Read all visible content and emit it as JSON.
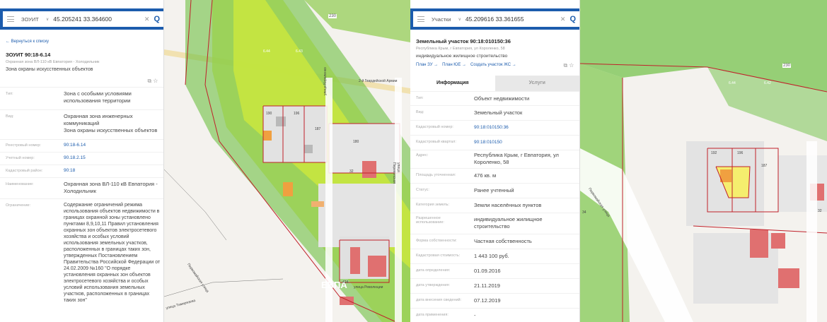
{
  "left": {
    "search": {
      "mode": "ЗОУИТ",
      "query": "45.205241 33.364600"
    },
    "back_link": "← Вернуться к списку",
    "title": "ЗОУИТ 90:18-6.14",
    "subtitle": "Охранная зона ВЛ-110 кВ Евпатория - Холодильник",
    "desc": "Зона охраны искусственных объектов",
    "rows": [
      {
        "key": "Тип:",
        "value": "Зона с особыми условиями использования территории"
      },
      {
        "key": "Вид:",
        "value": "Охранная зона инженерных коммуникаций",
        "value2": "Зона охраны искусственных объектов"
      },
      {
        "key": "Реестровый номер:",
        "value": "90:18-6.14"
      },
      {
        "key": "Учетный номер:",
        "value": "90.18.2.15"
      },
      {
        "key": "Кадастровый район:",
        "value": "90:18"
      },
      {
        "key": "Наименование:",
        "value": "Охранная зона ВЛ-110 кВ Евпатория - Холодильник"
      },
      {
        "key": "Ограничение:",
        "value": "Содержание ограничений режима использования объектов недвижимости в границах охранной зоны установлено пунктами 8,9,10,11 Правил установления охранных зон объектов электросетевого хозяйства и особых условий использования земельных участков, расположенных в границах таких зон, утвержденных Постановлением Правительства Российской Федерации от 24.02.2009 №160 \"О порядке установления охранных зон объектов электросетевого хозяйства и особых условий использования земельных участков, расположенных в границах таких зон\""
      }
    ],
    "map_labels": {
      "n230": "230",
      "n6_44": "6.44",
      "n6_43": "6.43",
      "street1": "2-й Гвардейской Армии",
      "street2": "улица Короленко",
      "street3": "улица Перекопская",
      "street4": "Первомайская улица",
      "street5": "улица Тимирязева",
      "street6": "улица Революции",
      "evpa": "ЕВПА",
      "p190": "190",
      "p196": "196",
      "p187": "187",
      "p192": "192",
      "p180": "180",
      "p32": "32",
      "p424": "424"
    }
  },
  "right": {
    "search": {
      "mode": "Участки",
      "query": "45.209616 33.361655"
    },
    "title": "Земельный участок 90:18:010150:36",
    "address_small": "Республика Крым, г Евпатория, ул Короленко, 58",
    "use_small": "индивидуальное жилищное строительство",
    "links": [
      "План ЗУ →",
      "План ЮЕ →",
      "Создать участок ЖС →"
    ],
    "tabs": [
      "Информация",
      "Услуги"
    ],
    "rows": [
      {
        "key": "Тип:",
        "value": "Объект недвижимости"
      },
      {
        "key": "Вид:",
        "value": "Земельный участок"
      },
      {
        "key": "Кадастровый номер:",
        "value": "90:18:010150:36"
      },
      {
        "key": "Кадастровый квартал:",
        "value": "90:18:010150"
      },
      {
        "key": "Адрес:",
        "value": "Республика Крым, г Евпатория, ул Короленко, 58"
      },
      {
        "key": "Площадь уточненная:",
        "value": "476 кв. м"
      },
      {
        "key": "Статус:",
        "value": "Ранее учтенный"
      },
      {
        "key": "Категория земель:",
        "value": "Земли населённых пунктов"
      },
      {
        "key": "Разрешенное использование:",
        "value": "индивидуальное жилищное строительство"
      },
      {
        "key": "Форма собственности:",
        "value": "Частная собственность"
      },
      {
        "key": "Кадастровая стоимость:",
        "value": "1 443 100 руб."
      },
      {
        "key": "дата определения:",
        "value": "01.09.2016"
      },
      {
        "key": "дата утверждения:",
        "value": "21.11.2019"
      },
      {
        "key": "дата внесения сведений:",
        "value": "07.12.2019"
      },
      {
        "key": "дата применения:",
        "value": "-"
      }
    ],
    "map_labels": {
      "n230": "230",
      "n6_44": "6.44",
      "n6_42": "6.42",
      "street1": "Первомайская улица",
      "p192": "192",
      "p196": "196",
      "p187": "187",
      "p34": "34",
      "p32": "32"
    }
  }
}
